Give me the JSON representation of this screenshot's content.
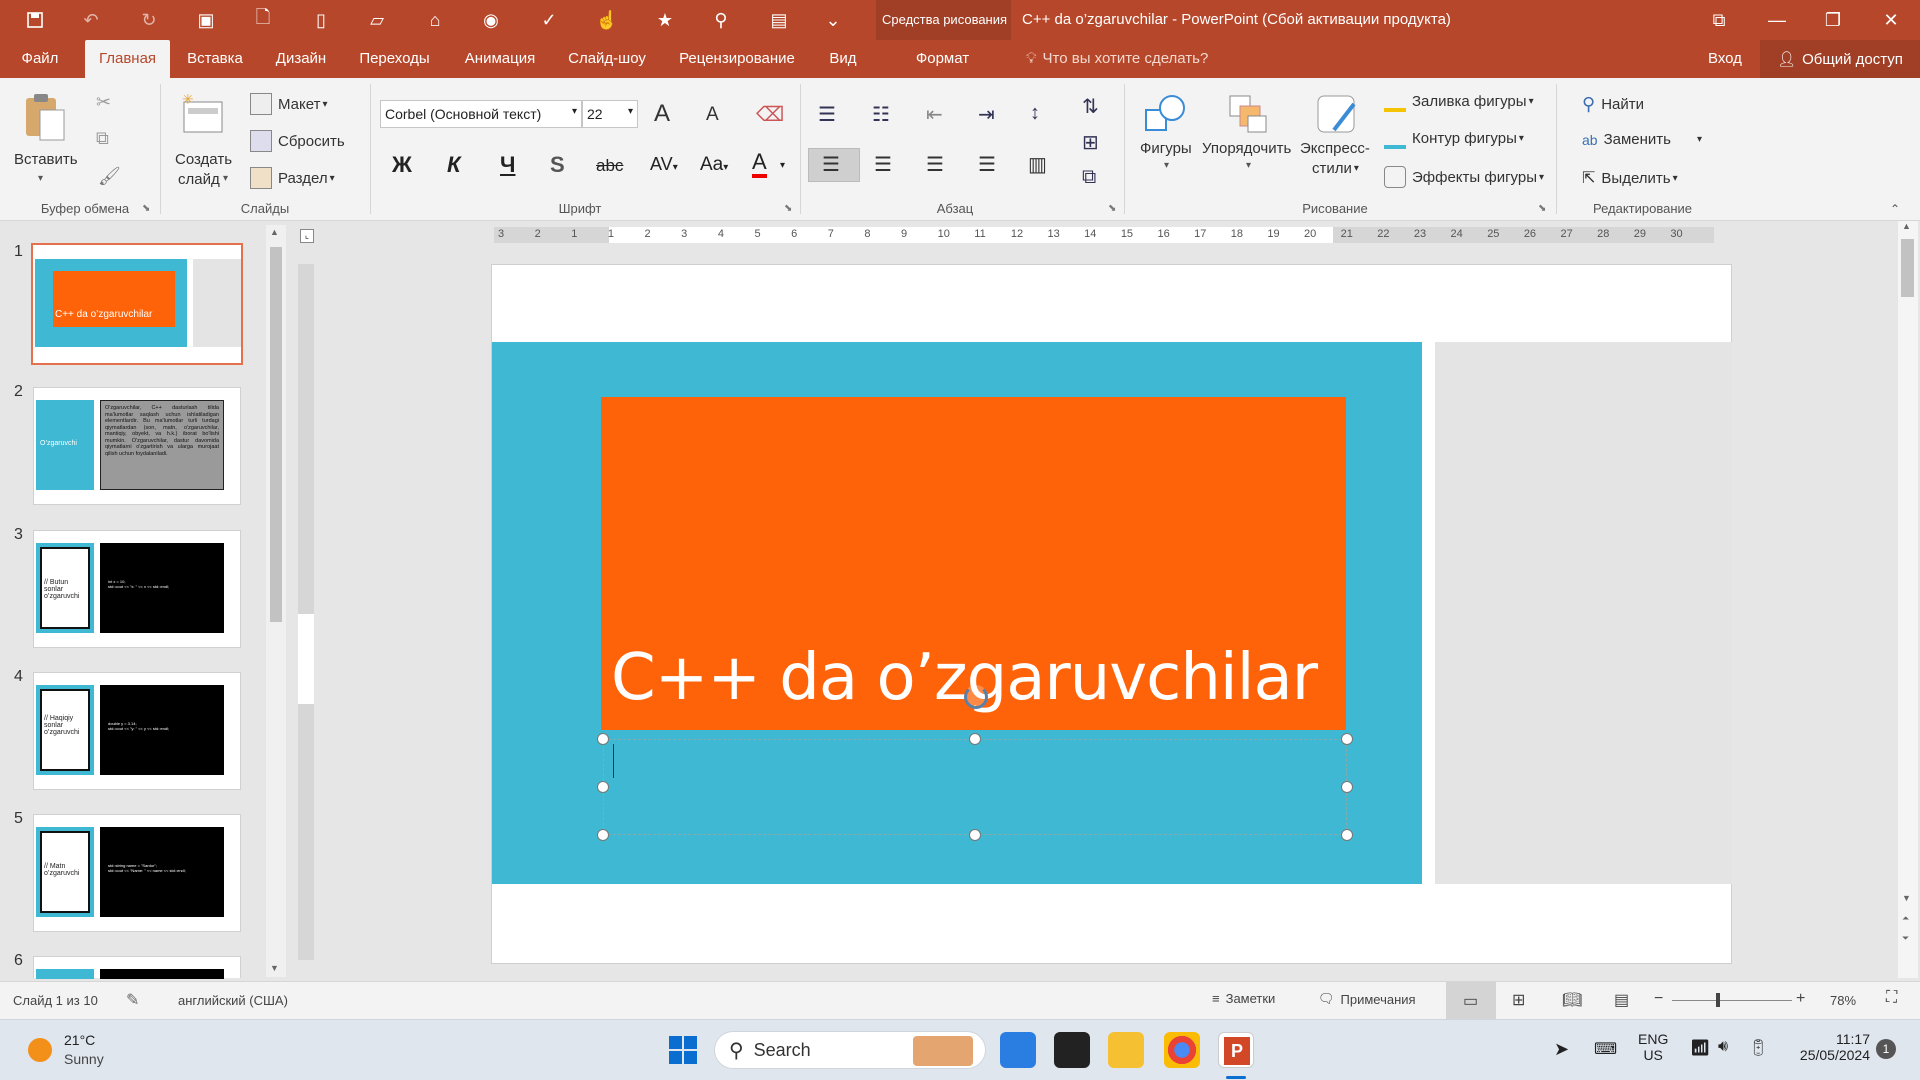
{
  "app": {
    "title": "C++ da o’zgaruvchilar - PowerPoint (Сбой активации продукта)",
    "context_label": "Средства рисования"
  },
  "tabs": [
    {
      "label": "Файл"
    },
    {
      "label": "Главная"
    },
    {
      "label": "Вставка"
    },
    {
      "label": "Дизайн"
    },
    {
      "label": "Переходы"
    },
    {
      "label": "Анимация"
    },
    {
      "label": "Слайд-шоу"
    },
    {
      "label": "Рецензирование"
    },
    {
      "label": "Вид"
    },
    {
      "label": "Формат"
    }
  ],
  "tellme": "Что вы хотите сделать?",
  "signin": "Вход",
  "share": "Общий доступ",
  "ribbon": {
    "clipboard": {
      "paste": "Вставить",
      "group": "Буфер обмена"
    },
    "slides": {
      "new_slide": "Создать",
      "new_slide2": "слайд",
      "layout": "Макет",
      "reset": "Сбросить",
      "section": "Раздел",
      "group": "Слайды"
    },
    "font": {
      "name": "Corbel (Основной текст)",
      "size": "22",
      "group": "Шрифт",
      "bold": "Ж",
      "italic": "К",
      "underline": "Ч",
      "shadow": "S",
      "strike": "abc",
      "spacing": "AV",
      "case": "Aa",
      "color": "A",
      "grow": "A",
      "shrink": "A"
    },
    "paragraph": {
      "group": "Абзац"
    },
    "drawing": {
      "shapes": "Фигуры",
      "arrange": "Упорядочить",
      "quick1": "Экспресс-",
      "quick2": "стили",
      "fill": "Заливка фигуры",
      "outline": "Контур фигуры",
      "effects": "Эффекты фигуры",
      "group": "Рисование"
    },
    "editing": {
      "find": "Найти",
      "replace": "Заменить",
      "select": "Выделить",
      "group": "Редактирование"
    }
  },
  "thumbnails": [
    {
      "num": "1",
      "text": "C++ da o’zgaruvchilar"
    },
    {
      "num": "2",
      "left": "O’zgaruvchi",
      "right": "O'zgaruvchilar, C++ dasturlash tilida ma'lumotlar saqlash uchun ishlatiladigan elementlardir. Bu ma'lumotlar turli turdagi qiymatlardan (son, matn, o'zgaruvchilar, mantiqiy, obyekt, va h.k.) iborat bo'lishi mumkin. O'zgaruvchilar, dastur davomida qiymatlarni o'zgartirish va ularga murojaat qilish uchun foydalaniladi."
    },
    {
      "num": "3",
      "left": "// Butun sonlar o’zgaruvchi",
      "right": "int x = 10;\nstd::cout << \"x: \" << x << std::endl;"
    },
    {
      "num": "4",
      "left": "// Haqiqiy sonlar o’zgaruvchi",
      "right": "double y = 3.14;\nstd::cout << \"y: \" << y << std::endl;"
    },
    {
      "num": "5",
      "left": "// Matn o’zgaruvchi",
      "right": "std::string name = \"Sardor\";\nstd::cout << \"Name: \" << name << std::endl;"
    },
    {
      "num": "6"
    }
  ],
  "slide": {
    "title": "C++ da o’zgaruvchilar",
    "colors": {
      "teal": "#3fb8d3",
      "orange": "#ff6309",
      "gray": "#e4e4e4"
    }
  },
  "ruler": {
    "h_ticks": [
      "3",
      "2",
      "1",
      "1",
      "2",
      "3",
      "4",
      "5",
      "6",
      "7",
      "8",
      "9",
      "10",
      "11",
      "12",
      "13",
      "14",
      "15",
      "16",
      "17",
      "18",
      "19",
      "20",
      "21",
      "22",
      "23",
      "24",
      "25",
      "26",
      "27",
      "28",
      "29",
      "30"
    ]
  },
  "status": {
    "slide_info": "Слайд 1 из 10",
    "language": "английский (США)",
    "notes": "Заметки",
    "comments": "Примечания",
    "zoom": "78%"
  },
  "taskbar": {
    "temp": "21°C",
    "weather": "Sunny",
    "search": "Search",
    "lang1": "ENG",
    "lang2": "US",
    "time": "11:17",
    "date": "25/05/2024",
    "notif": "1"
  }
}
